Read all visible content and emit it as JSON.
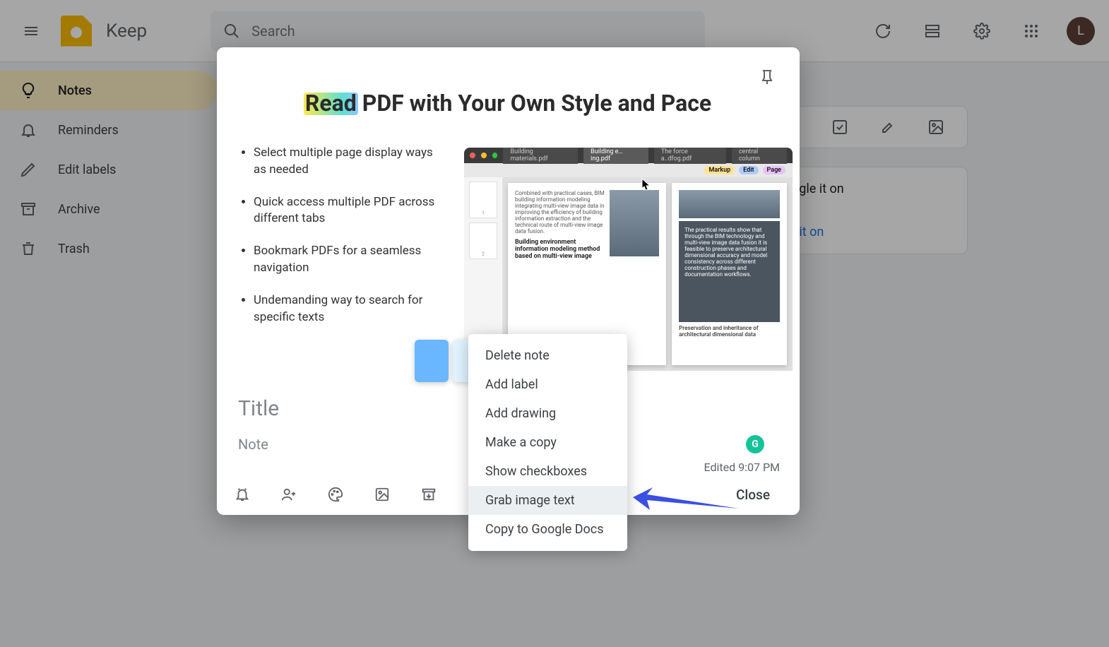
{
  "header": {
    "app_title": "Keep",
    "search_placeholder": "Search",
    "avatar_initial": "L"
  },
  "sidebar": {
    "items": [
      {
        "label": "Notes",
        "icon": "lightbulb-icon",
        "active": true
      },
      {
        "label": "Reminders",
        "icon": "bell-icon",
        "active": false
      },
      {
        "label": "Edit labels",
        "icon": "pencil-icon",
        "active": false
      },
      {
        "label": "Archive",
        "icon": "archive-icon",
        "active": false
      },
      {
        "label": "Trash",
        "icon": "trash-icon",
        "active": false
      }
    ]
  },
  "background_notes": {
    "note1_line1": "Toggle it on",
    "note1_link": "urn it on"
  },
  "modal": {
    "hero_highlight": "Read",
    "hero_rest": " PDF with Your Own Style and Pace",
    "bullets": [
      "Select multiple page display ways as needed",
      "Quick access multiple PDF across different tabs",
      "Bookmark PDFs for a seamless navigation",
      "Undemanding way to search for specific texts"
    ],
    "pdf_preview": {
      "tabs": [
        "Building materials.pdf",
        "Building e…ing.pdf",
        "The force a..dfog.pdf",
        "central column"
      ],
      "pills": [
        {
          "label": "Markup",
          "color": "#fde293"
        },
        {
          "label": "Edit",
          "color": "#aecbfa"
        },
        {
          "label": "Page",
          "color": "#e9c3f9"
        }
      ],
      "page1_caption": "Building environment information modeling method based on multi-view image",
      "page2_caption": "Preservation and inheritance of architectural dimensional data",
      "thumb_count": 2
    },
    "title_placeholder": "Title",
    "note_placeholder": "Note",
    "edited_label": "Edited 9:07 PM",
    "close_label": "Close",
    "toolbar_icons": [
      "reminder-icon",
      "collaborator-icon",
      "palette-icon",
      "image-icon",
      "archive-icon",
      "more-icon",
      "undo-icon",
      "redo-icon"
    ]
  },
  "context_menu": {
    "items": [
      "Delete note",
      "Add label",
      "Add drawing",
      "Make a copy",
      "Show checkboxes",
      "Grab image text",
      "Copy to Google Docs"
    ],
    "hovered_index": 5
  },
  "colors": {
    "accent": "#feefc3",
    "arrow": "#3b4fe4",
    "grammarly": "#15c39a"
  }
}
